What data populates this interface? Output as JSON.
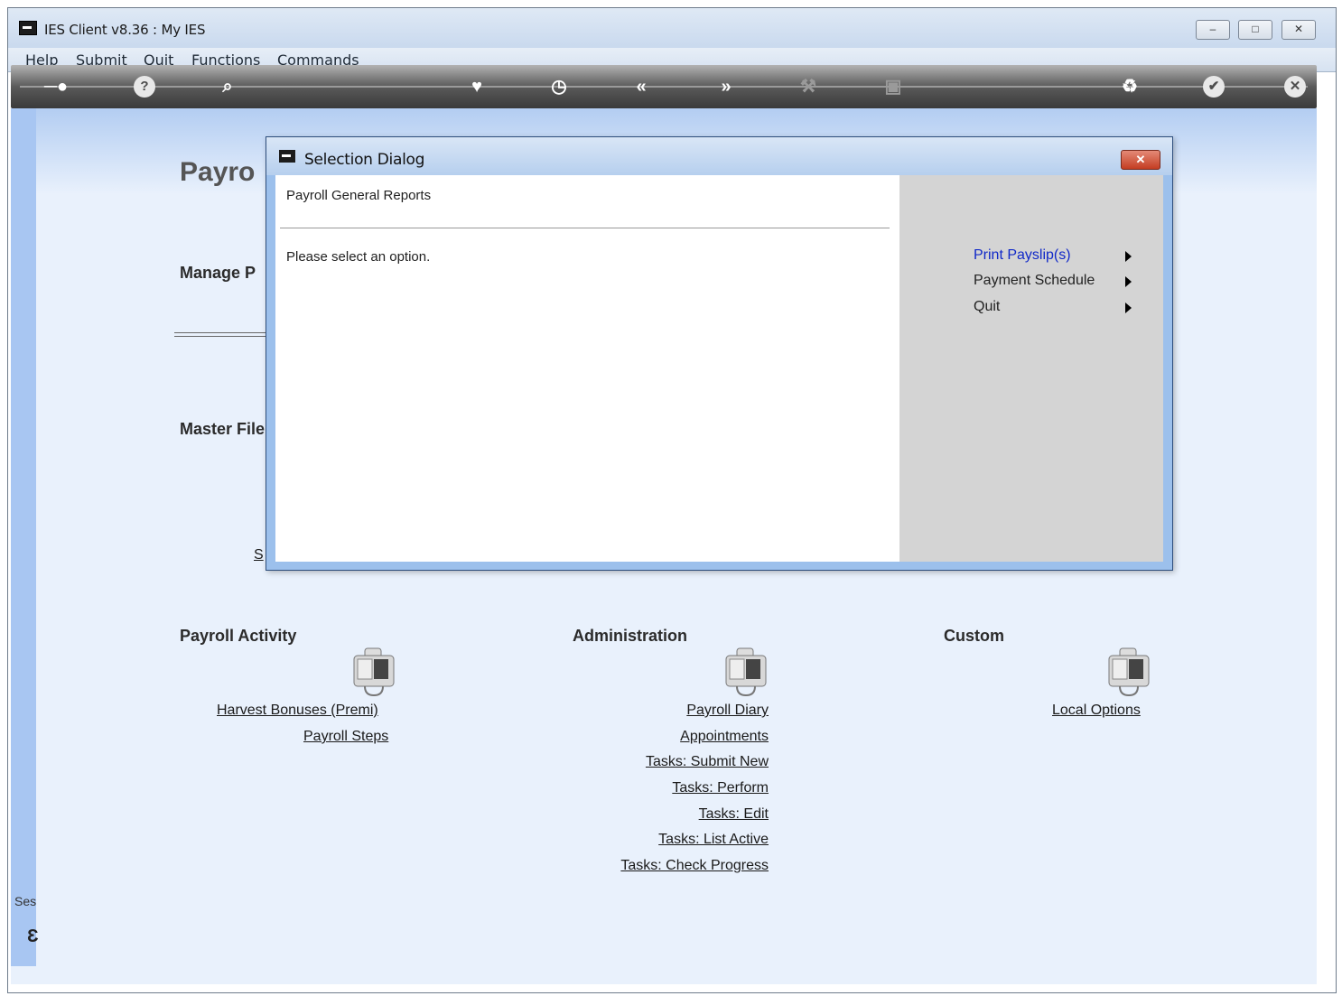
{
  "window": {
    "title": "IES Client v8.36 : My IES",
    "buttons": [
      "–",
      "□",
      "✕"
    ]
  },
  "menubar": [
    "Help",
    "Submit",
    "Quit",
    "Functions",
    "Commands"
  ],
  "toolbar": {
    "icons": [
      "key-icon",
      "help-icon",
      "search-icon",
      "heart-icon",
      "clock-icon",
      "back-icon",
      "forward-icon",
      "tools-icon",
      "chip-icon",
      "recycle-icon",
      "check-icon",
      "close-icon"
    ]
  },
  "page": {
    "title": "Payro",
    "manage": "Manage P",
    "master_files": "Master File",
    "partial_link": "S",
    "sections": {
      "payroll_activity": {
        "heading": "Payroll Activity",
        "links": [
          "Harvest Bonuses (Premi)",
          "Payroll Steps"
        ]
      },
      "administration": {
        "heading": "Administration",
        "links": [
          "Payroll Diary",
          "Appointments",
          "Tasks: Submit New",
          "Tasks: Perform",
          "Tasks: Edit",
          "Tasks: List Active",
          "Tasks: Check Progress"
        ]
      },
      "custom": {
        "heading": "Custom",
        "links": [
          "Local Options"
        ]
      }
    },
    "session_label": "Ses"
  },
  "dialog": {
    "caption": "Selection Dialog",
    "close": "✕",
    "subtitle": "Payroll General Reports",
    "message": "Please select an option.",
    "options": [
      "Print Payslip(s)",
      "Payment Schedule",
      "Quit"
    ],
    "highlight_color": "#1028c8"
  }
}
